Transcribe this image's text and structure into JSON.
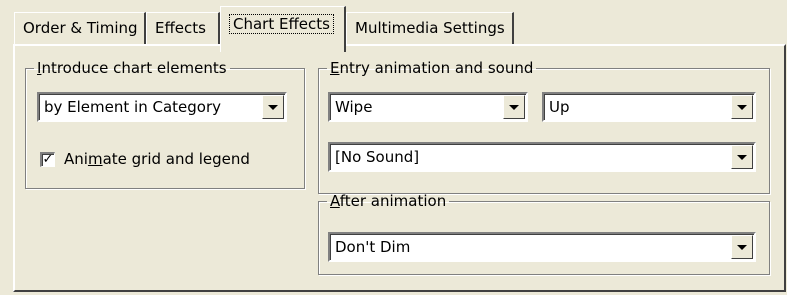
{
  "tabs": [
    {
      "label": "Order & Timing",
      "active": false
    },
    {
      "label": "Effects",
      "active": false
    },
    {
      "label": "Chart Effects",
      "active": true
    },
    {
      "label": "Multimedia Settings",
      "active": false
    }
  ],
  "introduce": {
    "legend_prefix": "",
    "legend_key": "I",
    "legend_suffix": "ntroduce chart elements",
    "select_value": "by Element in Category",
    "checkbox_checked": true,
    "checkbox_mark": "✓",
    "checkbox_prefix": "Ani",
    "checkbox_key": "m",
    "checkbox_suffix": "ate grid and legend"
  },
  "entry": {
    "legend_key": "E",
    "legend_suffix": "ntry animation and sound",
    "effect_value": "Wipe",
    "direction_value": "Up",
    "sound_value": "[No Sound]"
  },
  "after": {
    "legend_key": "A",
    "legend_suffix": "fter animation",
    "select_value": "Don't Dim"
  }
}
